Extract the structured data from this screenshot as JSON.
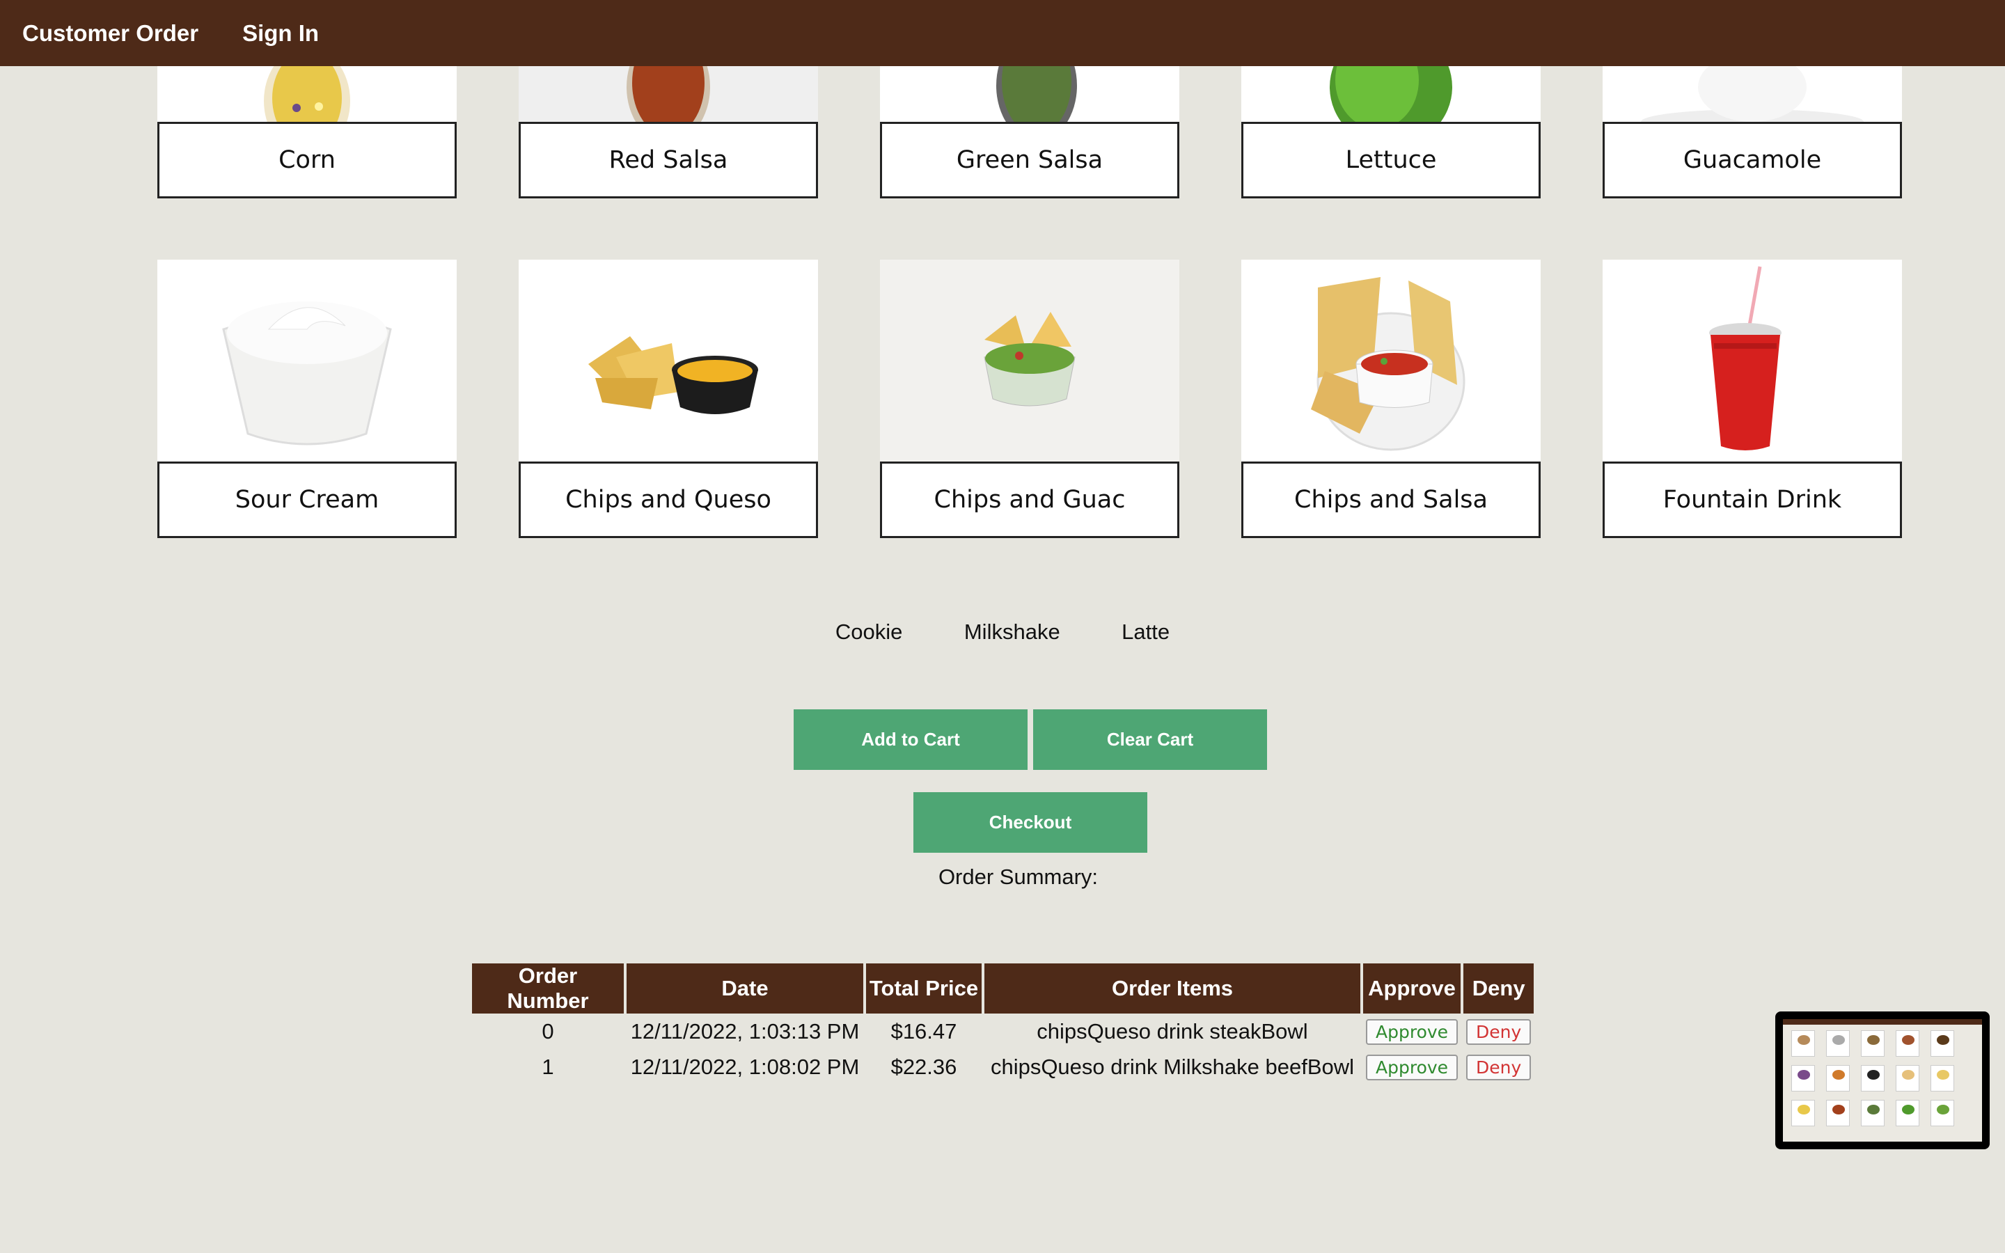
{
  "nav": {
    "brand": "Customer Order",
    "sign_in": "Sign In"
  },
  "menu_row1": [
    {
      "label": "Corn",
      "icon": "corn-bowl-image"
    },
    {
      "label": "Red Salsa",
      "icon": "red-salsa-image"
    },
    {
      "label": "Green Salsa",
      "icon": "green-salsa-image"
    },
    {
      "label": "Lettuce",
      "icon": "lettuce-image"
    },
    {
      "label": "Guacamole",
      "icon": "guacamole-image"
    }
  ],
  "menu_row2": [
    {
      "label": "Sour Cream",
      "icon": "sour-cream-image"
    },
    {
      "label": "Chips and Queso",
      "icon": "chips-queso-image"
    },
    {
      "label": "Chips and Guac",
      "icon": "chips-guac-image"
    },
    {
      "label": "Chips and Salsa",
      "icon": "chips-salsa-image"
    },
    {
      "label": "Fountain Drink",
      "icon": "fountain-drink-image"
    }
  ],
  "extras": [
    "Cookie",
    "Milkshake",
    "Latte"
  ],
  "buttons": {
    "add_to_cart": "Add to Cart",
    "clear_cart": "Clear Cart",
    "checkout": "Checkout"
  },
  "summary_title": "Order Summary:",
  "orders": {
    "headers": [
      "Order Number",
      "Date",
      "Total Price",
      "Order Items",
      "Approve",
      "Deny"
    ],
    "rows": [
      {
        "number": "0",
        "date": "12/11/2022, 1:03:13 PM",
        "total": "$16.47",
        "items": "chipsQueso drink steakBowl"
      },
      {
        "number": "1",
        "date": "12/11/2022, 1:08:02 PM",
        "total": "$22.36",
        "items": "chipsQueso drink Milkshake beefBowl"
      }
    ],
    "approve_label": "Approve",
    "deny_label": "Deny"
  },
  "colors": {
    "header_brown": "#4e2a18",
    "button_green": "#4ea674",
    "background": "#e6e5de"
  }
}
